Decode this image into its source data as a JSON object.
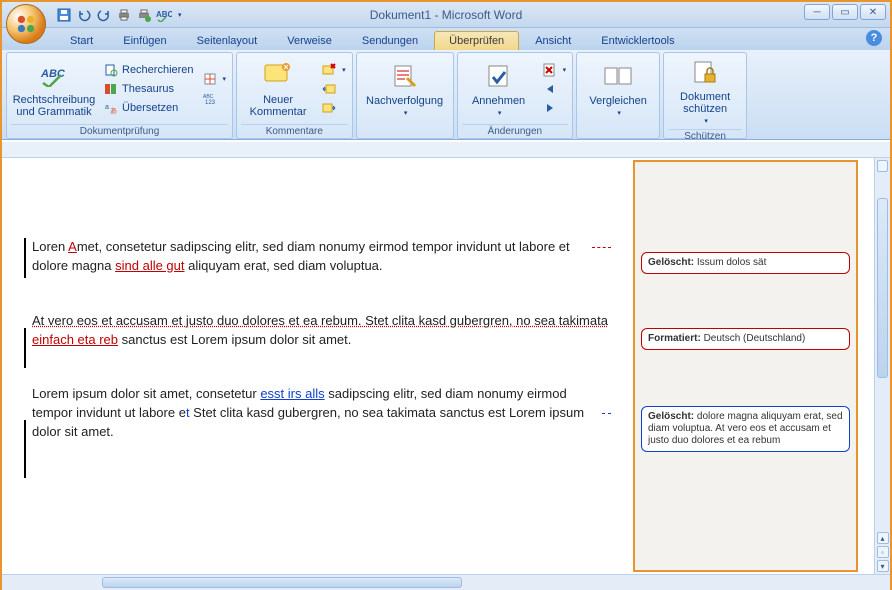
{
  "window": {
    "title": "Dokument1 - Microsoft Word"
  },
  "qat": {
    "save": "save-icon",
    "undo": "undo-icon",
    "redo": "redo-icon",
    "print": "print-icon",
    "quickprint": "quick-print-icon",
    "spellcheck": "spelling-icon"
  },
  "tabs": [
    {
      "label": "Start"
    },
    {
      "label": "Einfügen"
    },
    {
      "label": "Seitenlayout"
    },
    {
      "label": "Verweise"
    },
    {
      "label": "Sendungen"
    },
    {
      "label": "Überprüfen",
      "active": true
    },
    {
      "label": "Ansicht"
    },
    {
      "label": "Entwicklertools"
    }
  ],
  "ribbon": {
    "proofing": {
      "label": "Dokumentprüfung",
      "spelling": "Rechtschreibung und Grammatik",
      "research": "Recherchieren",
      "thesaurus": "Thesaurus",
      "translate": "Übersetzen"
    },
    "comments": {
      "label": "Kommentare",
      "new_comment": "Neuer Kommentar"
    },
    "tracking": {
      "label": "Nachverfolgung",
      "track": "Nachverfolgung"
    },
    "changes": {
      "label": "Änderungen",
      "accept": "Annehmen"
    },
    "compare": {
      "label": "Vergleichen",
      "compare": "Vergleichen"
    },
    "protect": {
      "label": "Schützen",
      "protect": "Dokument schützen"
    }
  },
  "document": {
    "paragraphs": [
      {
        "text_pre": "Loren ",
        "ins_red1": "A",
        "text_mid1": "met, consetetur sadipscing elitr, sed diam nonumy eirmod tempor invidunt ut labore et dolore magna ",
        "ins_red2": "sind alle gut",
        "text_post": " aliquyam erat, sed diam voluptua."
      },
      {
        "fmt_line": "At vero eos et accusam et justo duo dolores et ea rebum. Stet clita kasd gubergren, no sea takimata ",
        "ins_red": "einfach eta reb",
        "text_post": " sanctus est Lorem ipsum dolor sit amet."
      },
      {
        "text_pre": "Lorem ipsum dolor sit amet, consetetur ",
        "ins_blue": "esst irs alls",
        "text_mid": " sadipscing elitr, sed diam nonumy eirmod tempor invidunt ut labore e",
        "caret": "t",
        "text_post": " Stet clita kasd gubergren, no sea takimata sanctus est Lorem ipsum dolor sit amet."
      }
    ]
  },
  "balloons": [
    {
      "color": "red",
      "label": "Gelöscht:",
      "text": "Issum dolos sät"
    },
    {
      "color": "red",
      "label": "Formatiert:",
      "text": "Deutsch (Deutschland)"
    },
    {
      "color": "blue",
      "label": "Gelöscht:",
      "text": "dolore magna aliquyam erat, sed diam voluptua. At vero eos et accusam et justo duo dolores et ea rebum"
    }
  ]
}
